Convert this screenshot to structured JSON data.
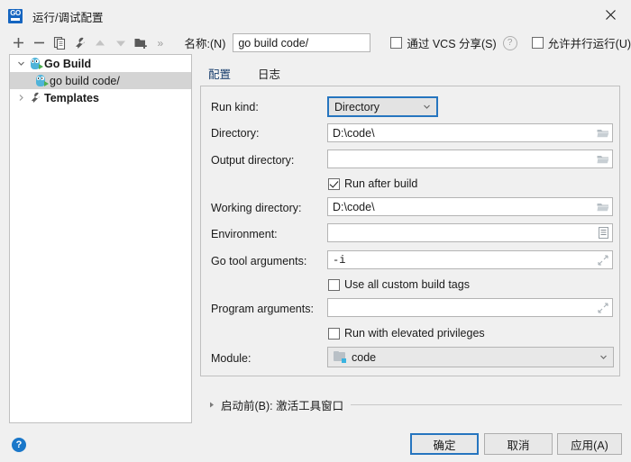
{
  "window": {
    "title": "运行/调试配置",
    "app_icon": "goland-icon",
    "close_label": "×"
  },
  "toolbar": {
    "icons": [
      {
        "name": "add-icon",
        "label": "+"
      },
      {
        "name": "remove-icon",
        "label": "−"
      },
      {
        "name": "copy-icon",
        "label": "copy"
      },
      {
        "name": "edit-templates-icon",
        "label": "wrench"
      },
      {
        "name": "move-up-icon",
        "label": "up"
      },
      {
        "name": "move-down-icon",
        "label": "down"
      },
      {
        "name": "new-folder-icon",
        "label": "folder-add"
      },
      {
        "name": "more-icon",
        "label": "»"
      }
    ],
    "name_label": "名称:(N)",
    "name_value": "go build code/",
    "share_vcs_label": "通过 VCS 分享(S)",
    "share_vcs_checked": false,
    "help_hint": "?",
    "allow_parallel_label": "允许并行运行(U)",
    "allow_parallel_checked": false
  },
  "tree": {
    "items": [
      {
        "label": "Go Build",
        "bold": true,
        "twisty": "chevron-down",
        "icon": "gopher-icon",
        "selected": false,
        "indent": 0
      },
      {
        "label": "go build code/",
        "bold": false,
        "twisty": "none",
        "icon": "gopher-icon",
        "selected": true,
        "indent": 1
      },
      {
        "label": "Templates",
        "bold": true,
        "twisty": "chevron-right",
        "icon": "wrench-icon",
        "selected": false,
        "indent": 0
      }
    ]
  },
  "tabs": [
    {
      "label": "配置",
      "active": true
    },
    {
      "label": "日志",
      "active": false
    }
  ],
  "form": {
    "run_kind": {
      "label": "Run kind:",
      "value": "Directory",
      "focused": true
    },
    "directory": {
      "label": "Directory:",
      "value": "D:\\code\\",
      "browse_icon": "folder-icon"
    },
    "output_directory": {
      "label": "Output directory:",
      "value": "",
      "browse_icon": "folder-icon"
    },
    "run_after_build": {
      "label": "Run after build",
      "checked": true
    },
    "working_directory": {
      "label": "Working directory:",
      "value": "D:\\code\\",
      "browse_icon": "folder-icon"
    },
    "environment": {
      "label": "Environment:",
      "value": "",
      "browse_icon": "list-icon"
    },
    "go_tool_arguments": {
      "label": "Go tool arguments:",
      "value": "-i",
      "browse_icon": "expand-icon"
    },
    "use_all_custom_build_tags": {
      "label": "Use all custom build tags",
      "checked": false
    },
    "program_arguments": {
      "label": "Program arguments:",
      "value": "",
      "browse_icon": "expand-icon"
    },
    "run_with_elevated_privileges": {
      "label": "Run with elevated privileges",
      "checked": false
    },
    "module": {
      "label": "Module:",
      "value": "code",
      "icon": "module-folder-icon"
    }
  },
  "before_launch": {
    "arrow": "chevron-right",
    "text": "启动前(B): 激活工具窗口"
  },
  "footer": {
    "help_label": "?",
    "ok_label": "确定",
    "cancel_label": "取消",
    "apply_label": "应用(A)"
  },
  "colors": {
    "accent": "#2675bf",
    "window_bg": "#f0f0f0",
    "panel_bg": "#ffffff",
    "selection": "#d4d4d4",
    "help_blue": "#1a77c9"
  }
}
